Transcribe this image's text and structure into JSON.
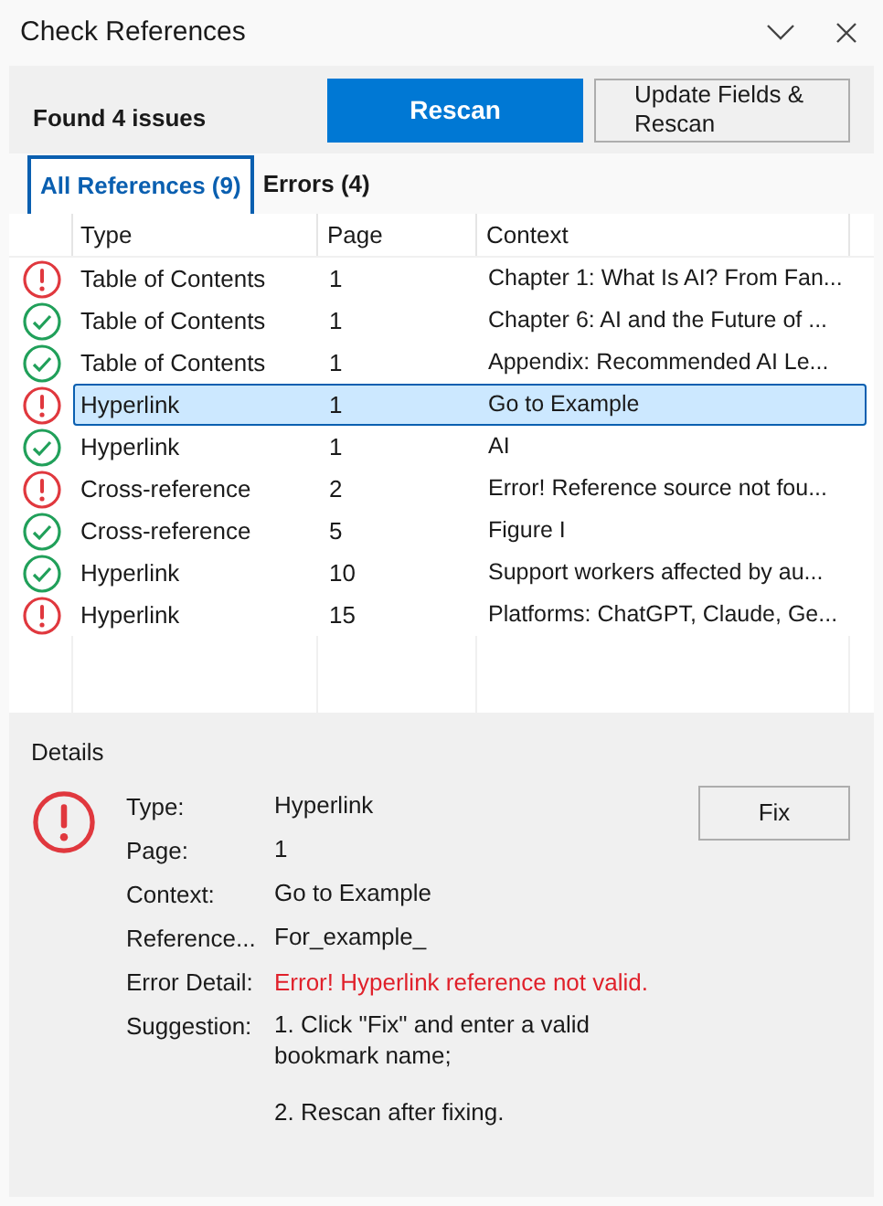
{
  "window": {
    "title": "Check References"
  },
  "summary": "Found 4 issues",
  "buttons": [
    {
      "label": "Rescan",
      "kind": "primary"
    },
    {
      "label": "Update Fields & Rescan",
      "kind": "secondary"
    }
  ],
  "tabs": [
    {
      "label": "All References (9)",
      "selected": true
    },
    {
      "label": "Errors (4)",
      "selected": false
    }
  ],
  "table": {
    "columns": [
      "Type",
      "Page",
      "Context"
    ],
    "rows": [
      {
        "error": true,
        "selected": false,
        "type": "Table of Contents",
        "page": "1",
        "context": "Chapter 1: What Is AI? From Fan..."
      },
      {
        "error": false,
        "selected": false,
        "type": "Table of Contents",
        "page": "1",
        "context": "Chapter 6: AI and the Future of ..."
      },
      {
        "error": false,
        "selected": false,
        "type": "Table of Contents",
        "page": "1",
        "context": "Appendix: Recommended AI Le..."
      },
      {
        "error": true,
        "selected": true,
        "type": "Hyperlink",
        "page": "1",
        "context": "Go to Example"
      },
      {
        "error": false,
        "selected": false,
        "type": "Hyperlink",
        "page": "1",
        "context": "AI"
      },
      {
        "error": true,
        "selected": false,
        "type": "Cross-reference",
        "page": "2",
        "context": "Error! Reference source not fou..."
      },
      {
        "error": false,
        "selected": false,
        "type": "Cross-reference",
        "page": "5",
        "context": "Figure I"
      },
      {
        "error": false,
        "selected": false,
        "type": "Hyperlink",
        "page": "10",
        "context": "Support workers affected by au..."
      },
      {
        "error": true,
        "selected": false,
        "type": "Hyperlink",
        "page": "15",
        "context": "Platforms: ChatGPT, Claude, Ge..."
      }
    ]
  },
  "details": {
    "title": "Details",
    "error": true,
    "fix_button": "Fix",
    "fields": [
      {
        "label": "Type:",
        "kind": "plain",
        "value": [
          "Hyperlink"
        ]
      },
      {
        "label": "Page:",
        "kind": "plain",
        "value": [
          "1"
        ]
      },
      {
        "label": "Context:",
        "kind": "plain",
        "value": [
          "Go to Example"
        ]
      },
      {
        "label": "Reference...",
        "kind": "plain",
        "value": [
          "For_example_"
        ]
      },
      {
        "label": "Error Detail:",
        "kind": "error",
        "value": [
          "Error! Hyperlink reference not valid."
        ]
      },
      {
        "label": "Suggestion:",
        "kind": "plain",
        "value": [
          "1. Click \"Fix\" and enter a valid bookmark name;",
          "2. Rescan after fixing."
        ]
      }
    ]
  }
}
